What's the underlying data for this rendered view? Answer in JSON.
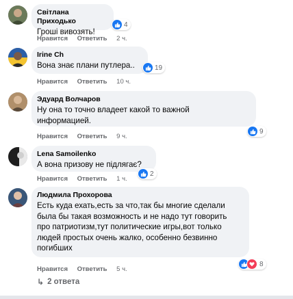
{
  "comments": [
    {
      "author": "Світлана Приходько",
      "text": "Гроші вивозять!",
      "actions": {
        "like": "Нравится",
        "reply": "Ответить",
        "time": "2 ч."
      },
      "reaction_count": "4",
      "reactions": [
        "like"
      ]
    },
    {
      "author": "Irine Ch",
      "text": "Вона знає плани путлера..",
      "actions": {
        "like": "Нравится",
        "reply": "Ответить",
        "time": "10 ч."
      },
      "reaction_count": "19",
      "reactions": [
        "like"
      ]
    },
    {
      "author": "Эдуард Волчаров",
      "text_lines": [
        "Ну она то точно владеет какой то важной",
        "информацией."
      ],
      "actions": {
        "like": "Нравится",
        "reply": "Ответить",
        "time": "9 ч."
      },
      "reaction_count": "9",
      "reactions": [
        "like"
      ]
    },
    {
      "author": "Lena Samoilenko",
      "text": "А вона призову не підлягає?",
      "actions": {
        "like": "Нравится",
        "reply": "Ответить",
        "time": "1 ч."
      },
      "reaction_count": "2",
      "reactions": [
        "like"
      ]
    },
    {
      "author": "Людмила Прохорова",
      "text_lines": [
        "Есть куда ехать,есть за что,так бы многие сделали",
        "была бы такая возможность и не надо тут говорить",
        "про патриотизм,тут политические игры,вот только",
        "людей простых очень жалко, особенно безвинно",
        "погибших"
      ],
      "actions": {
        "like": "Нравится",
        "reply": "Ответить",
        "time": "5 ч."
      },
      "reaction_count": "8",
      "reactions": [
        "like",
        "love"
      ]
    }
  ],
  "replies_link": "2 ответа",
  "colors": {
    "bubble": "#f0f2f5",
    "meta": "#65676b",
    "like": "#1877f2",
    "love": "#f33e58"
  }
}
